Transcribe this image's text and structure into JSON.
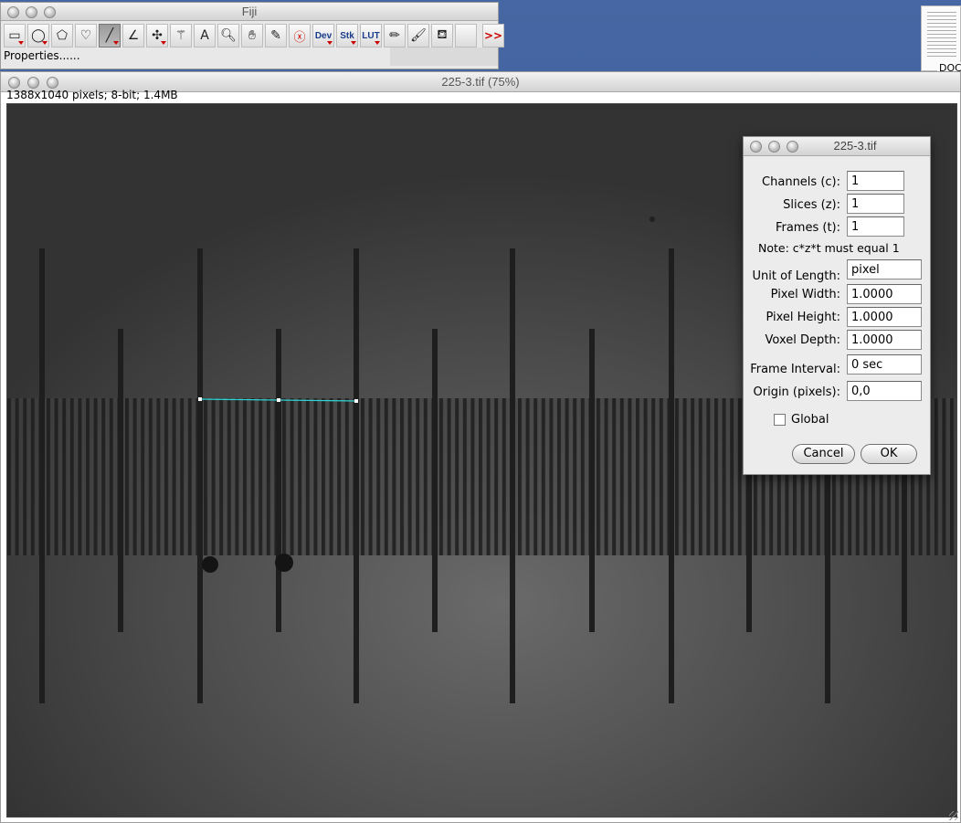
{
  "desktop": {
    "doc_label": "DOC"
  },
  "fiji": {
    "title": "Fiji",
    "tools": [
      {
        "name": "rectangle-tool-icon",
        "glyph": "▭",
        "dropdown": true
      },
      {
        "name": "oval-tool-icon",
        "glyph": "◯",
        "dropdown": true
      },
      {
        "name": "polygon-tool-icon",
        "glyph": "⬠",
        "dropdown": false
      },
      {
        "name": "freehand-tool-icon",
        "glyph": "♡",
        "dropdown": false
      },
      {
        "name": "line-tool-icon",
        "glyph": "╱",
        "dropdown": true,
        "active": true
      },
      {
        "name": "angle-tool-icon",
        "glyph": "∠",
        "dropdown": false
      },
      {
        "name": "point-tool-icon",
        "glyph": "✣",
        "dropdown": true
      },
      {
        "name": "wand-tool-icon",
        "glyph": "⚚",
        "dropdown": false
      },
      {
        "name": "text-tool-icon",
        "glyph": "A",
        "dropdown": false
      },
      {
        "name": "magnifier-tool-icon",
        "glyph": "🔍︎",
        "dropdown": false
      },
      {
        "name": "hand-tool-icon",
        "glyph": "✋︎",
        "dropdown": false
      },
      {
        "name": "color-picker-icon",
        "glyph": "✎",
        "dropdown": false
      },
      {
        "name": "stop-icon",
        "glyph": "ⓧ",
        "dropdown": false,
        "style": "red"
      },
      {
        "name": "dev-menu-icon",
        "glyph": "Dev",
        "dropdown": true,
        "style": "txt"
      },
      {
        "name": "stk-menu-icon",
        "glyph": "Stk",
        "dropdown": true,
        "style": "txt"
      },
      {
        "name": "lut-menu-icon",
        "glyph": "LUT",
        "dropdown": true,
        "style": "txt"
      },
      {
        "name": "pencil-tool-icon",
        "glyph": "✏︎",
        "dropdown": false
      },
      {
        "name": "brush-tool-icon",
        "glyph": "🖌︎",
        "dropdown": false
      },
      {
        "name": "flood-fill-icon",
        "glyph": "⛾",
        "dropdown": false
      },
      {
        "name": "empty-slot",
        "glyph": "",
        "dropdown": false
      },
      {
        "name": "more-tools-icon",
        "glyph": ">>",
        "dropdown": false,
        "style": "more"
      }
    ],
    "status": "Properties......"
  },
  "image_window": {
    "title": "225-3.tif (75%)",
    "info": "1388x1040 pixels; 8-bit; 1.4MB"
  },
  "dialog": {
    "title": "225-3.tif",
    "channels_label": "Channels (c):",
    "channels": "1",
    "slices_label": "Slices (z):",
    "slices": "1",
    "frames_label": "Frames (t):",
    "frames": "1",
    "note": "Note: c*z*t must equal 1",
    "unit_label": "Unit of Length:",
    "unit": "pixel",
    "pw_label": "Pixel Width:",
    "pixel_width": "1.0000",
    "ph_label": "Pixel Height:",
    "pixel_height": "1.0000",
    "vd_label": "Voxel Depth:",
    "voxel_depth": "1.0000",
    "fi_label": "Frame Interval:",
    "frame_interval": "0 sec",
    "origin_label": "Origin (pixels):",
    "origin": "0,0",
    "global_label": "Global",
    "global_checked": false,
    "cancel": "Cancel",
    "ok": "OK"
  },
  "colors": {
    "roi_line": "#2fd3d3",
    "desktop": "#3b5c9a"
  }
}
